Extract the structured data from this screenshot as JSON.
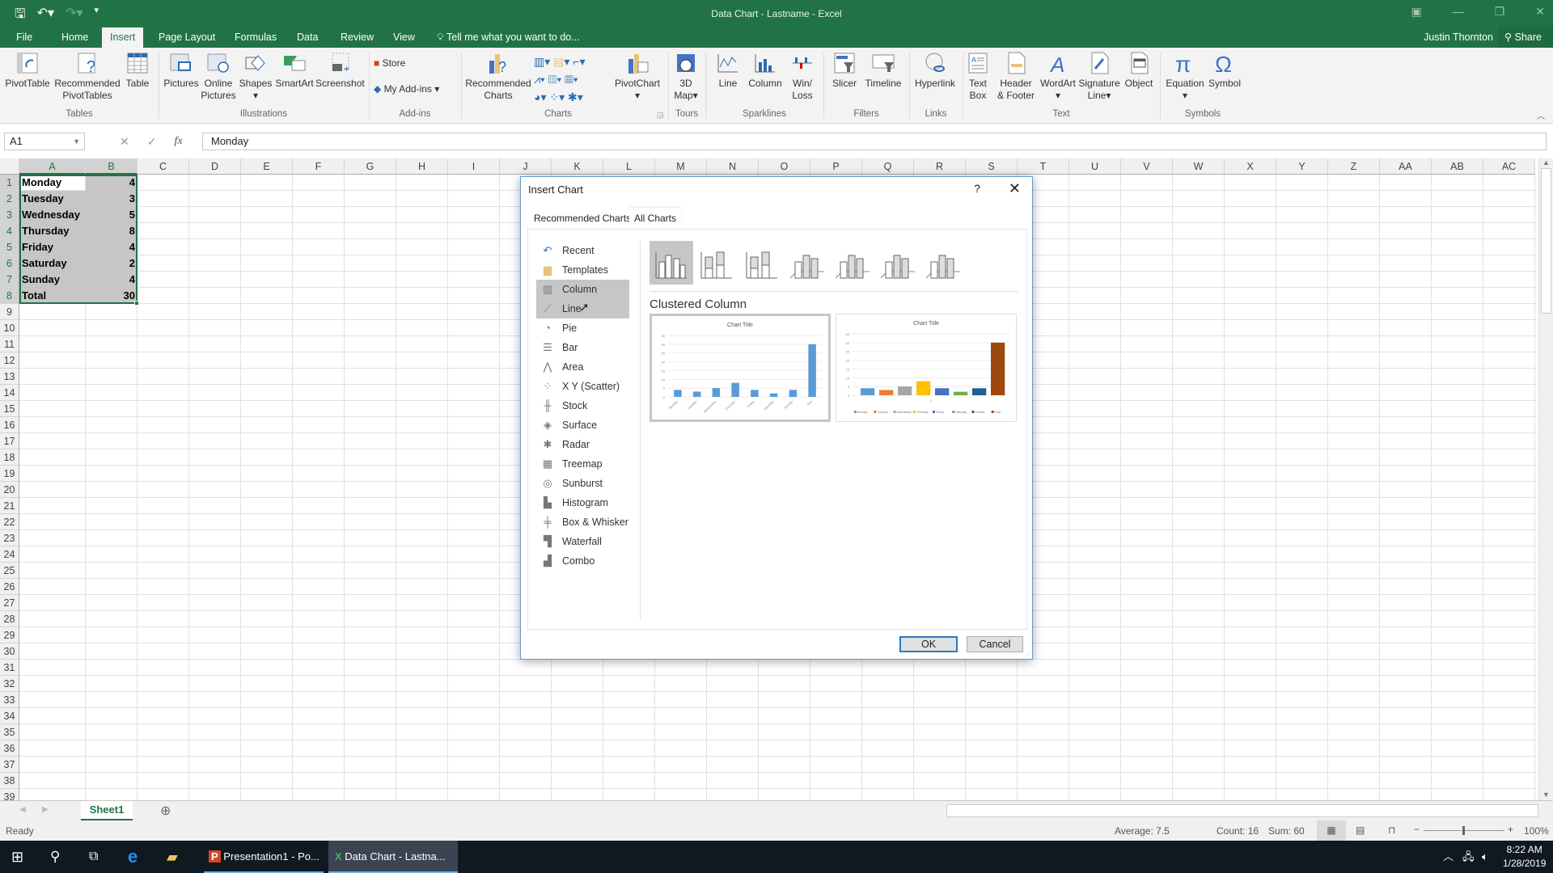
{
  "titlebar": {
    "title": "Data Chart - Lastname - Excel",
    "qat": [
      "save-icon",
      "undo-icon",
      "redo-icon",
      "customize-icon"
    ]
  },
  "tabs": [
    "File",
    "Home",
    "Insert",
    "Page Layout",
    "Formulas",
    "Data",
    "Review",
    "View"
  ],
  "active_tab": "Insert",
  "tell_me": "Tell me what you want to do...",
  "user": "Justin Thornton",
  "share": "Share",
  "ribbon": {
    "buttons": [
      {
        "label": "PivotTable"
      },
      {
        "label": "Recommended\nPivotTables"
      },
      {
        "label": "Table"
      },
      {
        "label": "Pictures"
      },
      {
        "label": "Online\nPictures"
      },
      {
        "label": "Shapes"
      },
      {
        "label": "SmartArt"
      },
      {
        "label": "Screenshot"
      },
      {
        "label": "Store"
      },
      {
        "label": "My Add-ins"
      },
      {
        "label": "Recommended\nCharts"
      },
      {
        "label": "PivotChart"
      },
      {
        "label": "3D\nMap"
      },
      {
        "label": "Line"
      },
      {
        "label": "Column"
      },
      {
        "label": "Win/\nLoss"
      },
      {
        "label": "Slicer"
      },
      {
        "label": "Timeline"
      },
      {
        "label": "Hyperlink"
      },
      {
        "label": "Text\nBox"
      },
      {
        "label": "Header\n& Footer"
      },
      {
        "label": "WordArt"
      },
      {
        "label": "Signature\nLine"
      },
      {
        "label": "Object"
      },
      {
        "label": "Equation"
      },
      {
        "label": "Symbol"
      }
    ],
    "groups": [
      "Tables",
      "Illustrations",
      "Add-ins",
      "Charts",
      "Tours",
      "Sparklines",
      "Filters",
      "Links",
      "Text",
      "Symbols"
    ]
  },
  "formula_bar": {
    "name_box": "A1",
    "formula": "Monday"
  },
  "columns": [
    "A",
    "B",
    "C",
    "D",
    "E",
    "F",
    "G",
    "H",
    "I",
    "J",
    "K",
    "L",
    "M",
    "N",
    "O",
    "P",
    "Q",
    "R",
    "S",
    "T",
    "U",
    "V",
    "W",
    "X",
    "Y",
    "Z",
    "AA",
    "AB",
    "AC"
  ],
  "rows": [
    "1",
    "2",
    "3",
    "4",
    "5",
    "6",
    "7",
    "8",
    "9",
    "10",
    "11",
    "12",
    "13",
    "14",
    "15",
    "16",
    "17",
    "18",
    "19",
    "20",
    "21",
    "22",
    "23",
    "24",
    "25",
    "26",
    "27",
    "28",
    "29",
    "30",
    "31",
    "32",
    "33",
    "34",
    "35",
    "36",
    "37",
    "38",
    "39"
  ],
  "cells": [
    {
      "a": "Monday",
      "b": "4"
    },
    {
      "a": "Tuesday",
      "b": "3"
    },
    {
      "a": "Wednesday",
      "b": "5"
    },
    {
      "a": "Thursday",
      "b": "8"
    },
    {
      "a": "Friday",
      "b": "4"
    },
    {
      "a": "Saturday",
      "b": "2"
    },
    {
      "a": "Sunday",
      "b": "4"
    },
    {
      "a": "Total",
      "b": "30"
    }
  ],
  "sheet_tab": "Sheet1",
  "status": {
    "ready": "Ready",
    "average": "Average: 7.5",
    "count": "Count: 16",
    "sum": "Sum: 60",
    "zoom": "100%"
  },
  "taskbar": {
    "apps": [
      "Presentation1 - Po...",
      "Data Chart - Lastna..."
    ],
    "time": "8:22 AM",
    "date": "1/28/2019"
  },
  "dialog": {
    "title": "Insert Chart",
    "help": "?",
    "close": "✕",
    "tabs": [
      "Recommended Charts",
      "All Charts"
    ],
    "active_tab": "All Charts",
    "chart_types": [
      {
        "label": "Recent",
        "icon": "↶"
      },
      {
        "label": "Templates",
        "icon": "▆"
      },
      {
        "label": "Column",
        "icon": "▥"
      },
      {
        "label": "Line",
        "icon": "⟋"
      },
      {
        "label": "Pie",
        "icon": "◔"
      },
      {
        "label": "Bar",
        "icon": "☰"
      },
      {
        "label": "Area",
        "icon": "⋀"
      },
      {
        "label": "X Y (Scatter)",
        "icon": "⁘"
      },
      {
        "label": "Stock",
        "icon": "╫"
      },
      {
        "label": "Surface",
        "icon": "◈"
      },
      {
        "label": "Radar",
        "icon": "✱"
      },
      {
        "label": "Treemap",
        "icon": "▦"
      },
      {
        "label": "Sunburst",
        "icon": "◎"
      },
      {
        "label": "Histogram",
        "icon": "▙"
      },
      {
        "label": "Box & Whisker",
        "icon": "╪"
      },
      {
        "label": "Waterfall",
        "icon": "▜"
      },
      {
        "label": "Combo",
        "icon": "▟"
      }
    ],
    "selected_type": "Column",
    "hover_type": "Line",
    "subtype_title": "Clustered Column",
    "ok": "OK",
    "cancel": "Cancel"
  },
  "chart_data": [
    {
      "type": "bar",
      "title": "Chart Title",
      "categories": [
        "Monday",
        "Tuesday",
        "Wednesday",
        "Thursday",
        "Friday",
        "Saturday",
        "Sunday",
        "Total"
      ],
      "values": [
        4,
        3,
        5,
        8,
        4,
        2,
        4,
        30
      ],
      "ylim": [
        0,
        35
      ],
      "yticks": [
        0,
        5,
        10,
        15,
        20,
        25,
        30,
        35
      ],
      "color": "#5b9bd5",
      "legend": "none"
    },
    {
      "type": "bar",
      "title": "Chart Title",
      "categories": [
        "1"
      ],
      "series": [
        {
          "name": "Monday",
          "values": [
            4
          ],
          "color": "#5b9bd5"
        },
        {
          "name": "Tuesday",
          "values": [
            3
          ],
          "color": "#ed7d31"
        },
        {
          "name": "Wednesday",
          "values": [
            5
          ],
          "color": "#a5a5a5"
        },
        {
          "name": "Thursday",
          "values": [
            8
          ],
          "color": "#ffc000"
        },
        {
          "name": "Friday",
          "values": [
            4
          ],
          "color": "#4472c4"
        },
        {
          "name": "Saturday",
          "values": [
            2
          ],
          "color": "#70ad47"
        },
        {
          "name": "Sunday",
          "values": [
            4
          ],
          "color": "#255e91"
        },
        {
          "name": "Total",
          "values": [
            30
          ],
          "color": "#9e480e"
        }
      ],
      "ylim": [
        0,
        35
      ],
      "yticks": [
        0,
        5,
        10,
        15,
        20,
        25,
        30,
        35
      ],
      "legend": "bottom"
    }
  ]
}
